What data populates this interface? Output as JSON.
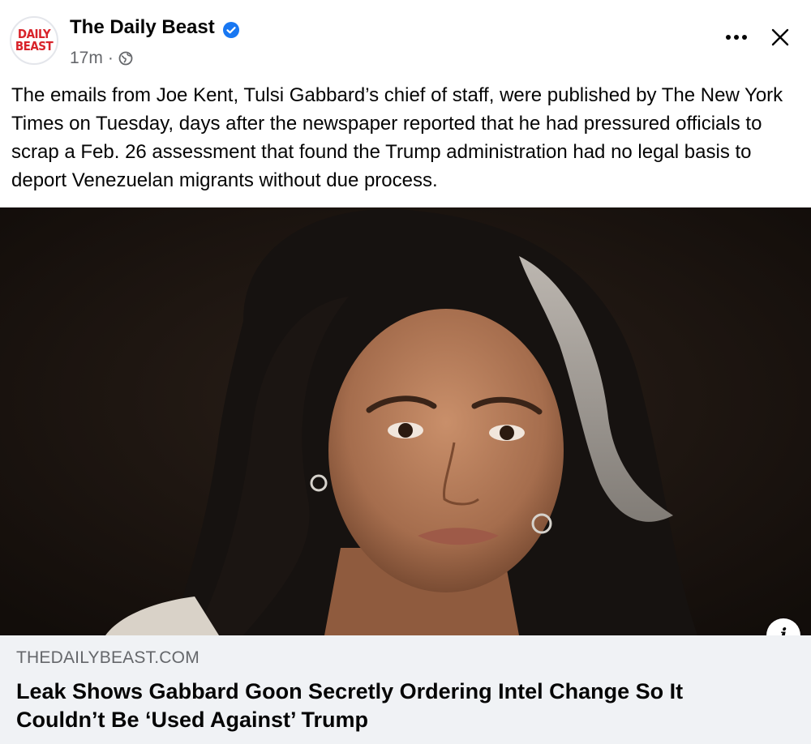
{
  "post": {
    "page_name": "The Daily Beast",
    "avatar_text": "DAILY\nBEAST",
    "timestamp": "17m",
    "separator": "·",
    "privacy_icon": "globe-icon",
    "verified_icon": "verified-badge-icon",
    "more_icon": "more-options-icon",
    "more_label": "•••",
    "close_icon": "close-icon",
    "body_text": "The emails from Joe Kent, Tulsi Gabbard’s chief of staff, were published by The New York Times on Tuesday, days after the newspaper reported that he had pressured officials to scrap a Feb. 26 assessment that found the Trump administration had no legal basis to deport Venezuelan migrants without due process."
  },
  "link_preview": {
    "domain": "THEDAILYBEAST.COM",
    "title": "Leak Shows Gabbard Goon Secretly Ordering Intel Change So It Couldn’t Be ‘Used Against’ Trump",
    "info_label": "i",
    "info_icon": "info-icon"
  },
  "colors": {
    "brand_red": "#d8232a",
    "verified_blue": "#1877f2",
    "secondary_text": "#65676b",
    "card_background": "#f0f2f5"
  }
}
